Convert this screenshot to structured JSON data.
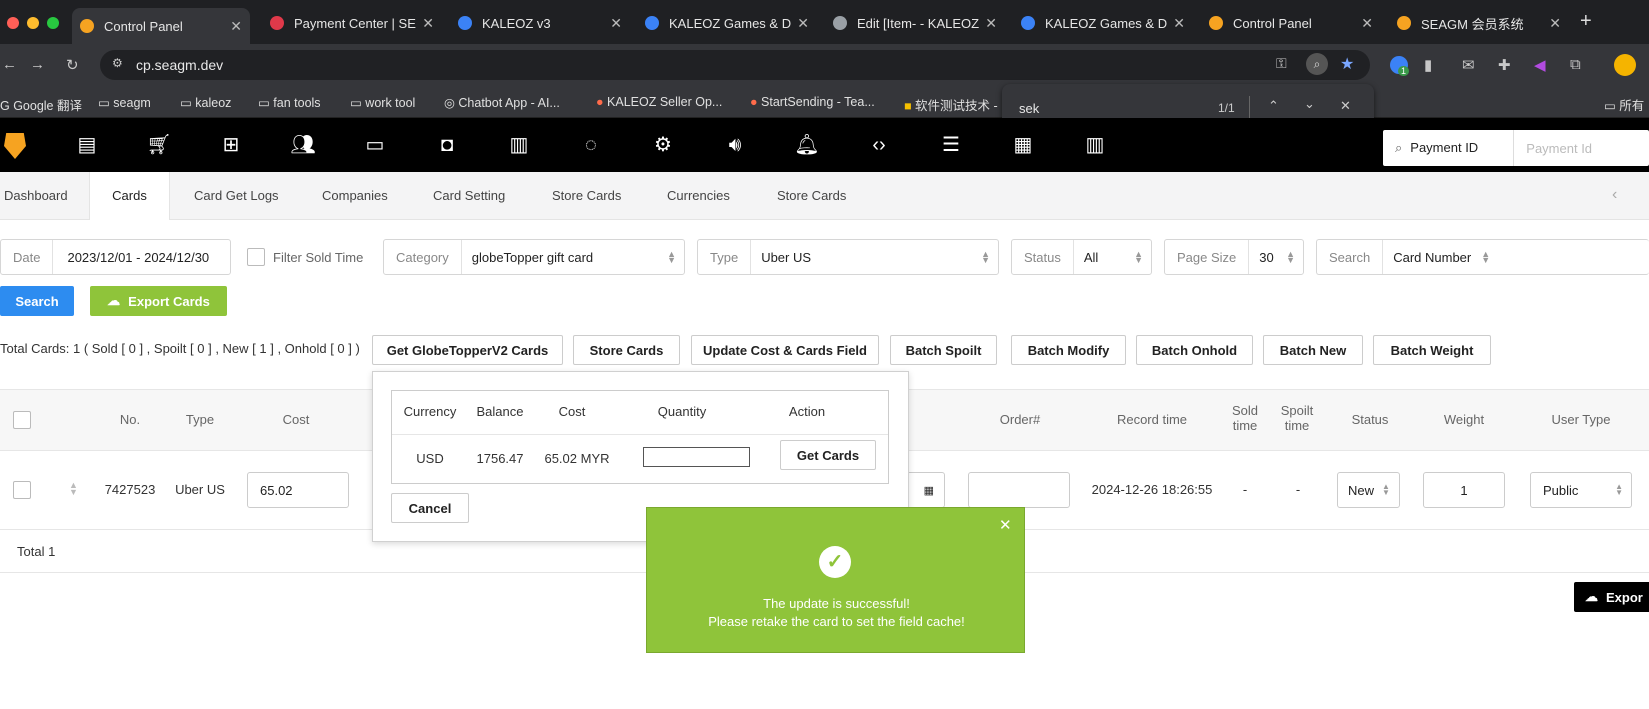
{
  "browser": {
    "tabs": [
      {
        "title": "Control Panel",
        "active": true,
        "fav": "#f6a321"
      },
      {
        "title": "Payment Center | SE",
        "fav": "#e0394a"
      },
      {
        "title": "KALEOZ v3",
        "fav": "#3b82f6"
      },
      {
        "title": "KALEOZ Games & Di",
        "fav": "#3b82f6"
      },
      {
        "title": "Edit [Item- - KALEOZ",
        "fav": "#9aa0a6"
      },
      {
        "title": "KALEOZ Games & Di",
        "fav": "#3b82f6"
      },
      {
        "title": "Control Panel",
        "fav": "#f6a321"
      },
      {
        "title": "SEAGM 会员系统",
        "fav": "#f6a321"
      }
    ],
    "url": "cp.seagm.dev",
    "bookmarks": [
      "Google 翻译",
      "seagm",
      "kaleoz",
      "fan tools",
      "work tool",
      "Chatbot App - AI...",
      "KALEOZ Seller Op...",
      "StartSending - Tea...",
      "软件测试技术 -",
      "所有"
    ],
    "find": {
      "query": "sek",
      "count": "1/1"
    },
    "extension_badge": "1"
  },
  "search": {
    "label": "Payment ID",
    "placeholder": "Payment Id"
  },
  "subtabs": [
    "Dashboard",
    "Cards",
    "Card Get Logs",
    "Companies",
    "Card Setting",
    "Store Cards",
    "Currencies",
    "Store Cards"
  ],
  "filters": {
    "date_label": "Date",
    "date_value": "2023/12/01 - 2024/12/30",
    "filter_sold_time": "Filter Sold Time",
    "category_label": "Category",
    "category_value": "globeTopper gift card",
    "type_label": "Type",
    "type_value": "Uber US",
    "status_label": "Status",
    "status_value": "All",
    "pagesize_label": "Page Size",
    "pagesize_value": "30",
    "search_label": "Search",
    "search_value": "Card Number"
  },
  "actions": {
    "search": "Search",
    "export": "Export Cards"
  },
  "summary": "Total Cards: 1 ( Sold [ 0 ] , Spoilt [ 0 ] , New [ 1 ] , Onhold [ 0 ] )",
  "batch_buttons": [
    "Get GlobeTopperV2 Cards",
    "Store Cards",
    "Update Cost & Cards Field",
    "Batch Spoilt",
    "Batch Modify",
    "Batch Onhold",
    "Batch New",
    "Batch Weight"
  ],
  "table": {
    "headers": {
      "no": "No.",
      "type": "Type",
      "cost": "Cost",
      "order": "Order#",
      "record": "Record time",
      "sold": "Sold time",
      "spoilt": "Spoilt time",
      "status": "Status",
      "weight": "Weight",
      "usertype": "User Type"
    },
    "row": {
      "no": "7427523",
      "type": "Uber US",
      "cost": "65.02",
      "record": "2024-12-26 18:26:55",
      "sold": "-",
      "spoilt": "-",
      "status": "New",
      "weight": "1",
      "usertype": "Public"
    },
    "total": "Total 1"
  },
  "modal": {
    "headers": {
      "currency": "Currency",
      "balance": "Balance",
      "cost": "Cost",
      "quantity": "Quantity",
      "action": "Action"
    },
    "row": {
      "currency": "USD",
      "balance": "1756.47",
      "cost": "65.02 MYR"
    },
    "get_cards": "Get Cards",
    "cancel": "Cancel"
  },
  "toast": {
    "line1": "The update is successful!",
    "line2": "Please retake the card to set the field cache!",
    "color": "#8fc43a"
  },
  "export_button_partial": "Expor"
}
